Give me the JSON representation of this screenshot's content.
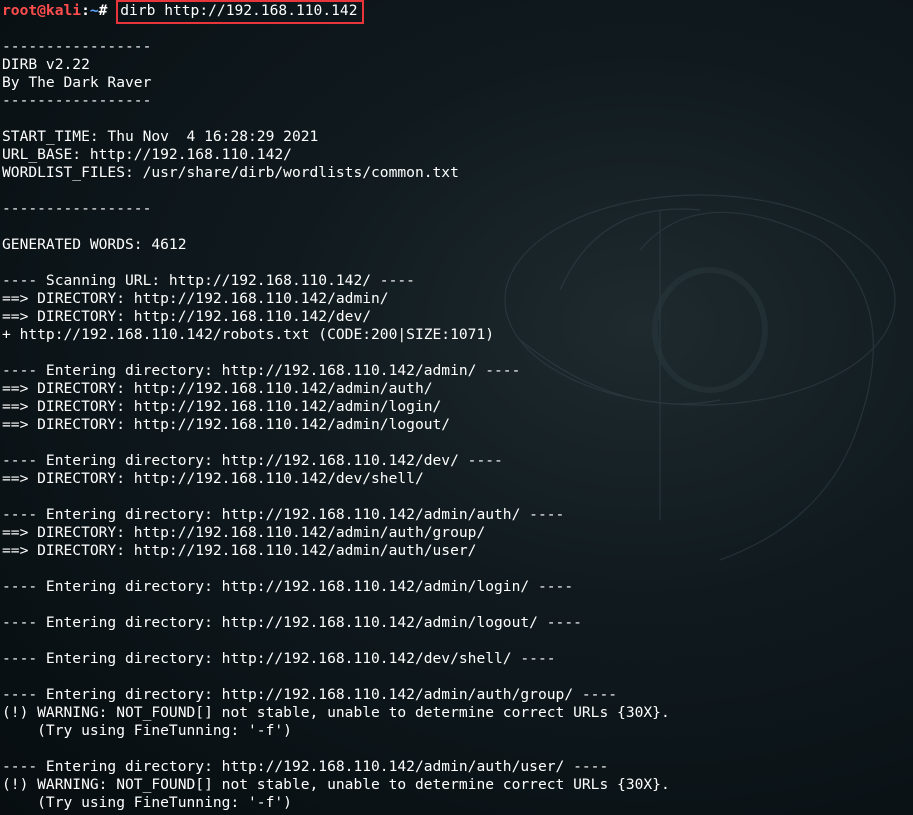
{
  "prompt": {
    "user_host": "root@kali",
    "separator": ":",
    "path": "~",
    "symbol": "#",
    "command": "dirb http://192.168.110.142"
  },
  "output": [
    "",
    "-----------------",
    "DIRB v2.22",
    "By The Dark Raver",
    "-----------------",
    "",
    "START_TIME: Thu Nov  4 16:28:29 2021",
    "URL_BASE: http://192.168.110.142/",
    "WORDLIST_FILES: /usr/share/dirb/wordlists/common.txt",
    "",
    "-----------------",
    "",
    "GENERATED WORDS: 4612",
    "",
    "---- Scanning URL: http://192.168.110.142/ ----",
    "==> DIRECTORY: http://192.168.110.142/admin/",
    "==> DIRECTORY: http://192.168.110.142/dev/",
    "+ http://192.168.110.142/robots.txt (CODE:200|SIZE:1071)",
    "",
    "---- Entering directory: http://192.168.110.142/admin/ ----",
    "==> DIRECTORY: http://192.168.110.142/admin/auth/",
    "==> DIRECTORY: http://192.168.110.142/admin/login/",
    "==> DIRECTORY: http://192.168.110.142/admin/logout/",
    "",
    "---- Entering directory: http://192.168.110.142/dev/ ----",
    "==> DIRECTORY: http://192.168.110.142/dev/shell/",
    "",
    "---- Entering directory: http://192.168.110.142/admin/auth/ ----",
    "==> DIRECTORY: http://192.168.110.142/admin/auth/group/",
    "==> DIRECTORY: http://192.168.110.142/admin/auth/user/",
    "",
    "---- Entering directory: http://192.168.110.142/admin/login/ ----",
    "",
    "---- Entering directory: http://192.168.110.142/admin/logout/ ----",
    "",
    "---- Entering directory: http://192.168.110.142/dev/shell/ ----",
    "",
    "---- Entering directory: http://192.168.110.142/admin/auth/group/ ----",
    "(!) WARNING: NOT_FOUND[] not stable, unable to determine correct URLs {30X}.",
    "    (Try using FineTunning: '-f')",
    "",
    "---- Entering directory: http://192.168.110.142/admin/auth/user/ ----",
    "(!) WARNING: NOT_FOUND[] not stable, unable to determine correct URLs {30X}.",
    "    (Try using FineTunning: '-f')"
  ],
  "colors": {
    "user_host": "#ff4d4d",
    "path": "#5fa8ff",
    "highlight_box": "#e8353b",
    "text": "#ffffff",
    "background": "#0a1418"
  }
}
